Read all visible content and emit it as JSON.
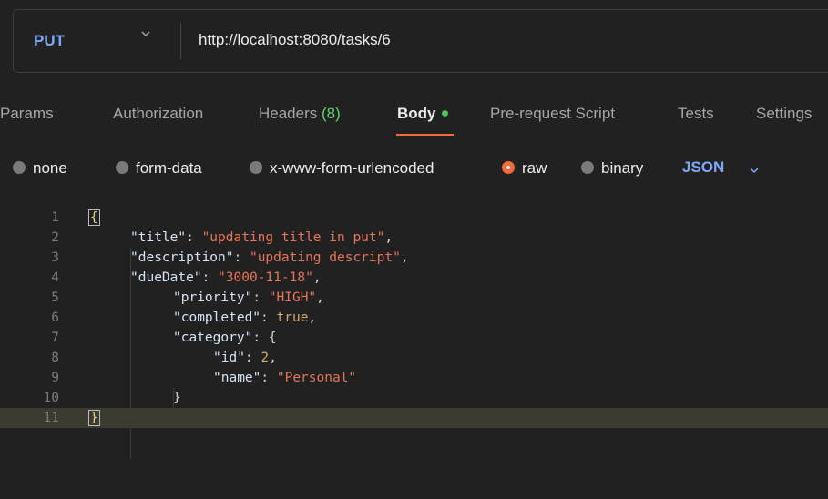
{
  "request": {
    "method": "PUT",
    "url": "http://localhost:8080/tasks/6"
  },
  "tabs": [
    {
      "label": "Params"
    },
    {
      "label": "Authorization"
    },
    {
      "label": "Headers",
      "count": "(8)"
    },
    {
      "label": "Body"
    },
    {
      "label": "Pre-request Script"
    },
    {
      "label": "Tests"
    },
    {
      "label": "Settings"
    }
  ],
  "body_options": {
    "none": "none",
    "form_data": "form-data",
    "urlencoded": "x-www-form-urlencoded",
    "raw": "raw",
    "binary": "binary",
    "selected": "raw",
    "format": "JSON"
  },
  "editor": {
    "line_numbers": [
      "1",
      "2",
      "3",
      "4",
      "5",
      "6",
      "7",
      "8",
      "9",
      "10",
      "11"
    ],
    "open_brace": "{",
    "close_brace": "}",
    "fields": {
      "title_key": "\"title\"",
      "title_val": "\"updating title in put\"",
      "description_key": "\"description\"",
      "description_val": "\"updating descript\"",
      "dueDate_key": "\"dueDate\"",
      "dueDate_val": "\"3000-11-18\"",
      "priority_key": "\"priority\"",
      "priority_val": "\"HIGH\"",
      "completed_key": "\"completed\"",
      "completed_val": "true",
      "category_key": "\"category\"",
      "id_key": "\"id\"",
      "id_val": "2",
      "name_key": "\"name\"",
      "name_val": "\"Personal\""
    }
  },
  "colors": {
    "method": "#7ea8f8",
    "accent": "#f26b3a",
    "success": "#4cc15a",
    "string": "#e5745a",
    "number": "#d4a86a"
  }
}
